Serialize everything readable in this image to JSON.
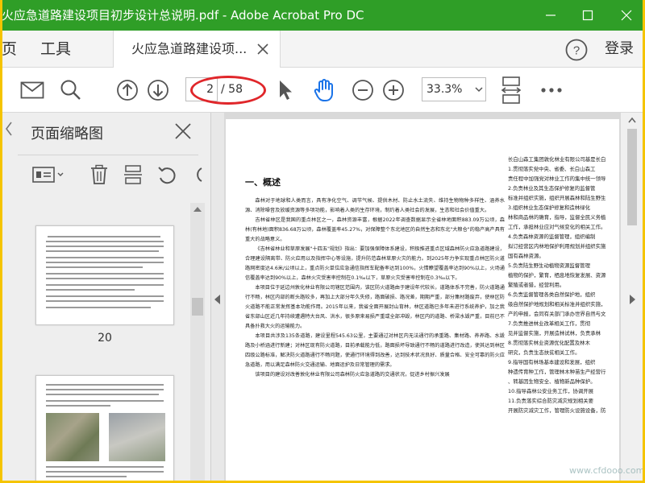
{
  "window": {
    "title": "火应急道路建设项目初步设计总说明.pdf - Adobe Acrobat Pro DC"
  },
  "menu": {
    "home": "页",
    "tools": "工具",
    "doc_tab": "火应急道路建设项...",
    "login": "登录"
  },
  "toolbar": {
    "page_current": "2",
    "page_total": "/ 58",
    "zoom": "33.3%"
  },
  "thumbnails_panel": {
    "title": "页面缩略图",
    "page_label": "20"
  },
  "document": {
    "heading": "一、概述",
    "col1_paragraphs": [
      "森林对于地球和人类而言，具有净化空气、调节气候、提供木材、防止水土流失、维持生物物种多样性、涵养水源、消除噪音及放缓资源等多项功能，影响着人类的生存环境，制约着人类社会的发展，生态和社会价值重大。",
      "吉林省林区是我国的重点林区之一，森林资源丰富，根据2022年调查数据显示全省林地面积883.09万公顷，森林(有林地)面积836.68万公顷，森林覆盖率45.27%，对保障整个东北地区的自然生态和东北\"大粮仓\"的稳产高产具有重大的战略意义。",
      "《吉林省林业和草原发展\"十四五\"规划》指出：要加强保障体系建设，积极推进重点区域森林防火应急道路建设，合理建设隔离带、防火应用以及指挥中心等设施，提升防范森林草原火灾的能力。到2025年力争实现重点林区防火道路网密度达4.6米/公顷以上，重点防火单位应急通信指挥车配备率达到100%，火情瞭望覆盖率达到90%以上，火场通信覆盖率达到90%以上，森林火灾受害率控制在0.1‰以下，草原火灾受害率控制在0.3‰以下。",
      "本项目位于延边州敦化林业有限公司辖区范围内，该区防火道路由于建设年代较长，道路体系不完善，防火道路通行不畅，林区内部的断头路较多，再加上大部分年久失修，路面破损、路况差，期期严重，部分集材路废弃，使林区防火道路不能正常发挥基本功能作用。2015年以来，我省全面开展封山育林，林区道路已多年未进行系统养护，加之我省东部山区近几年持续遭遇特大台风、洪水，很多原来易损严重或全部冲毁，林区内的道路、桥梁水毁严重，目前已不具备扑救大火的运输能力。",
      "本项目共涉及135条道路，建设里程545.63公里，主要通过对林区内无法通行的承重路、集材路、养养路、水毁路及小桥涵进行新建；对林区现有防火道路，目前承载能力低，路面损坏导致通行不畅的道路进行改造，使其达到林区四级公路标准，解决防火道路通行不畅问题，使通行环境得到改善，达到技术状况良好、质量合格、安全可靠的防火应急道路，用以满足森林防火交通运输、地面运护及日常管理的需求。",
      "该项目的建设对改善敦化林业有限公司森林防火应急道路的交通状况，促进乡村振兴发展"
    ],
    "col2_lines": [
      "长白山森工集团敦化林业有限公司基是长白",
      "1.贯彻落实党中央、省委、长白山森工",
      "责任程中加强党对林业工作的集中统一领导",
      "2.负责林业及其生态保护修复的监督管",
      "标准并组织实施，组织开展森林和陆生野生",
      "3.组织林业生态保护修复和造林绿化",
      "林和商品林的确育，指导，监督全民义务植",
      "工作，承担林业应对气候变化的相关工作。",
      "4.负责森林资源的监督管理，组织编制",
      "拟订经营区内林地保护利用规划并组织实施",
      "国有森林资源。",
      "5.负责陆生野生动植物资源监督管理",
      "植物的保护，繁育，栖息地恢复发展、资源",
      "繁殖或者猎，经营利用。",
      "6.负责监督管理各类自然保护地，组织",
      "级自然保护地规划和相关标准并组织实施，",
      "产的申报，会同有关部门承办世界自然与文",
      "7.负责推进林业改革相关工作，贯彻",
      "见并监督实施，开展造林试林，负责承林",
      "8.贯彻落实林业资源优化配置及林木",
      "研究，负责生态扶贫相关工作。",
      "9.指导国有林场基本建设和发展，组织",
      "种遗传育种工作，管理林木种苗生产经营行",
      "、转基因生物安全、植物新品种保护。",
      "10.指导森林公安业务工作，协调开展",
      "11.负责落实综合防灾减灾规划相关要",
      "开展防灾减灾工作，管理防火设施设备，防"
    ]
  },
  "icons": {
    "mail": "mail-icon",
    "search": "search-icon",
    "prev_page": "arrow-up-circle-icon",
    "next_page": "arrow-down-circle-icon",
    "select": "cursor-icon",
    "hand": "hand-icon",
    "zoom_out": "zoom-out-icon",
    "zoom_in": "zoom-in-icon",
    "fit_page": "fit-page-icon",
    "more": "more-icon"
  },
  "colors": {
    "titlebar": "#2f9e27",
    "hand_tool": "#1a73e8",
    "annotation": "#e0262a",
    "frame": "#f5c400"
  },
  "watermark": "www.cfdooo.com"
}
